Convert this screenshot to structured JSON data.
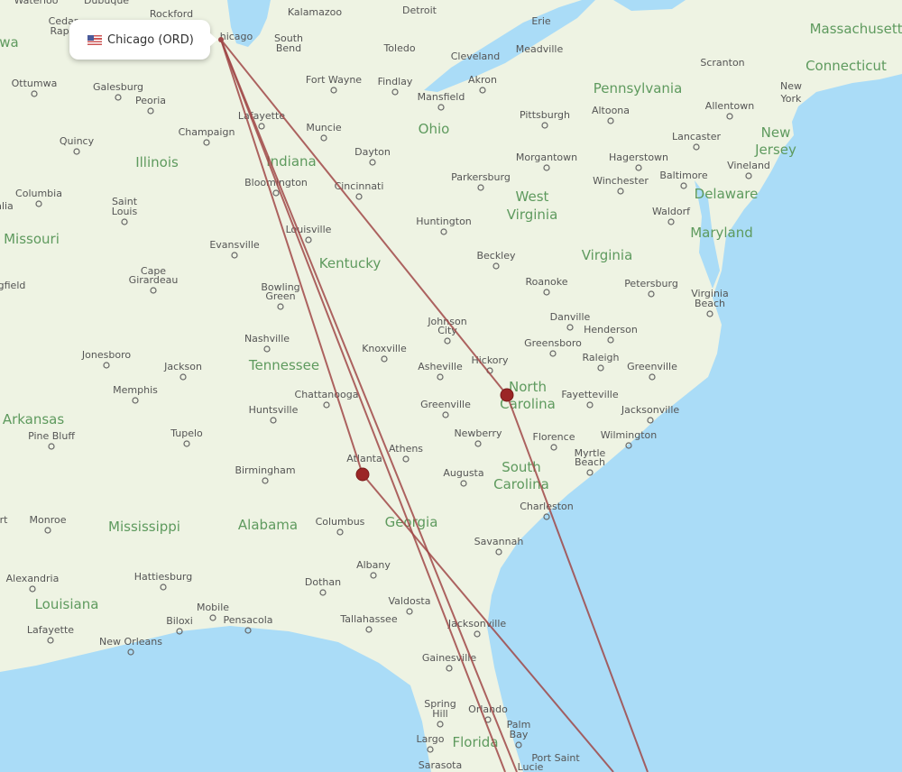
{
  "origin": {
    "label": "Chicago (ORD)",
    "flag_icon": "us-flag-icon"
  },
  "colors": {
    "land": "#eef3e3",
    "water": "#aadcf7",
    "route": "#a04848",
    "marker": "#9b2626"
  },
  "states": [
    "wa",
    "Illinois",
    "Indiana",
    "Ohio",
    "Pennsylvania",
    "West",
    "Virginia",
    "Virginia",
    "Maryland",
    "Delaware",
    "New",
    "Jersey",
    "Connecticut",
    "Massachusetts",
    "Kentucky",
    "Missouri",
    "Tennessee",
    "North",
    "Carolina",
    "South",
    "Carolina",
    "Georgia",
    "Alabama",
    "Mississippi",
    "Arkansas",
    "Louisiana",
    "Florida"
  ],
  "cities": [
    "Waterloo",
    "Dubuque",
    "Rockford",
    "Kalamazoo",
    "Detroit",
    "Erie",
    "Cedar",
    "Rap",
    "hicago",
    "South",
    "Bend",
    "Toledo",
    "Cleveland",
    "Meadville",
    "Scranton",
    "Ottumwa",
    "Galesburg",
    "Peoria",
    "Fort Wayne",
    "Findlay",
    "Akron",
    "Mansfield",
    "Pittsburgh",
    "Altoona",
    "Allentown",
    "New",
    "York",
    "Quincy",
    "Champaign",
    "Lafayette",
    "Muncie",
    "Dayton",
    "Morgantown",
    "Hagerstown",
    "Lancaster",
    "Baltimore",
    "Vineland",
    "Columbia",
    "Saint",
    "Louis",
    "Bloomington",
    "Cincinnati",
    "Parkersburg",
    "Winchester",
    "Waldorf",
    "Huntington",
    "Evansville",
    "Louisville",
    "Beckley",
    "Cape",
    "Girardeau",
    "Bowling",
    "Green",
    "Roanoke",
    "Petersburg",
    "Virginia",
    "Beach",
    "gfield",
    "Johnson",
    "City",
    "Danville",
    "Henderson",
    "Nashville",
    "Knoxville",
    "Greensboro",
    "Raleigh",
    "Greenville",
    "Jonesboro",
    "Jackson",
    "Asheville",
    "Hickory",
    "Memphis",
    "Chattanooga",
    "Fayetteville",
    "Huntsville",
    "Greenville",
    "Jacksonville",
    "Pine Bluff",
    "Tupelo",
    "Athens",
    "Newberry",
    "Florence",
    "Wilmington",
    "Myrtle",
    "Beach",
    "Atlanta",
    "Birmingham",
    "Augusta",
    "Monroe",
    "Columbus",
    "Charleston",
    "Savannah",
    "Hattiesburg",
    "Alexandria",
    "Dothan",
    "Albany",
    "Valdosta",
    "Mobile",
    "Pensacola",
    "Tallahassee",
    "Jacksonville",
    "Lafayette",
    "Biloxi",
    "New Orleans",
    "Gainesville",
    "Spring",
    "Hill",
    "Orlando",
    "Palm",
    "Bay",
    "Largo",
    "Port Saint",
    "Lucie",
    "Sarasota",
    "alia",
    "rt"
  ]
}
